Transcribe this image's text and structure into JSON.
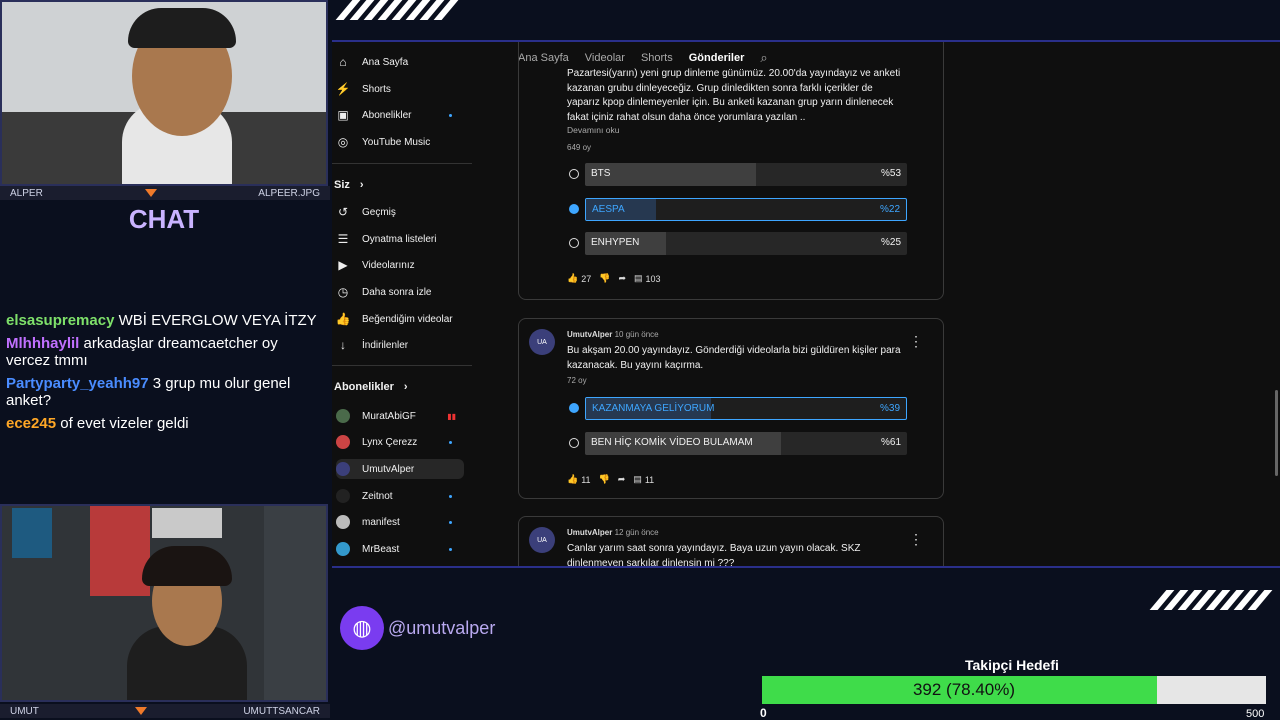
{
  "webcam_top": {
    "left_label": "ALPER",
    "right_label": "ALPEER.JPG"
  },
  "webcam_bottom": {
    "left_label": "UMUT",
    "right_label": "UMUTTSANCAR"
  },
  "chat": {
    "title": "CHAT",
    "messages": [
      {
        "user": "elsasupremacy",
        "color": "#7ee06a",
        "text": "WBİ EVERGLOW VEYA İTZY"
      },
      {
        "user": "Mlhhhaylil",
        "color": "#c070ff",
        "text": "arkadaşlar dreamcaetcher oy vercez tmmı"
      },
      {
        "user": "Partyparty_yeahh97",
        "color": "#4a8cff",
        "text": "3 grup mu olur genel anket?"
      },
      {
        "user": "ece245",
        "color": "#ffa726",
        "text": "of evet vizeler geldi"
      }
    ]
  },
  "youtube": {
    "topnav": [
      "Ana Sayfa",
      "Videolar",
      "Shorts",
      "Gönderiler"
    ],
    "active_tab": "Gönderiler",
    "sidebar": {
      "main": [
        "Ana Sayfa",
        "Shorts",
        "Abonelikler",
        "YouTube Music"
      ],
      "you_header": "Siz",
      "you": [
        "Geçmiş",
        "Oynatma listeleri",
        "Videolarınız",
        "Daha sonra izle",
        "Beğendiğim videolar",
        "İndirilenler"
      ],
      "subs_header": "Abonelikler",
      "subs": [
        "MuratAbiGF",
        "Lynx Çerezz",
        "UmutvAlper",
        "Zeitnot",
        "manifest",
        "MrBeast"
      ]
    },
    "posts": [
      {
        "text": "Pazartesi(yarın) yeni grup dinleme günümüz. 20.00'da yayındayız ve anketi kazanan grubu dinleyeceğiz. Grup dinledikten sonra farklı içerikler de yaparız kpop dinlemeyenler için. Bu anketi kazanan grup yarın dinlenecek fakat içiniz rahat olsun daha önce yorumlara yazılan ..",
        "read_more": "Devamını oku",
        "votes": "649 oy",
        "options": [
          {
            "label": "BTS",
            "pct": "%53",
            "value": 53,
            "selected": false
          },
          {
            "label": "AESPA",
            "pct": "%22",
            "value": 22,
            "selected": true
          },
          {
            "label": "ENHYPEN",
            "pct": "%25",
            "value": 25,
            "selected": false
          }
        ],
        "likes": "27",
        "comments": "103"
      },
      {
        "author": "UmutvAlper",
        "time": "10 gün önce",
        "text": "Bu akşam 20.00 yayındayız. Gönderdiği videolarla bizi güldüren kişiler para kazanacak. Bu yayını kaçırma.",
        "votes": "72 oy",
        "options": [
          {
            "label": "KAZANMAYA GELİYORUM",
            "pct": "%39",
            "value": 39,
            "selected": true
          },
          {
            "label": "BEN HİÇ KOMİK VİDEO BULAMAM",
            "pct": "%61",
            "value": 61,
            "selected": false
          }
        ],
        "likes": "11",
        "comments": "11"
      },
      {
        "author": "UmutvAlper",
        "time": "12 gün önce",
        "text": "Canlar yarım saat sonra yayındayız. Baya uzun yayın olacak. SKZ dinlenmeyen şarkılar dinlensin mi ???"
      }
    ]
  },
  "social_handle": "@umutvalper",
  "goal": {
    "title": "Takipçi Hedefi",
    "text": "392 (78.40%)",
    "fraction": 0.784,
    "min": "0",
    "max": "500"
  },
  "colors": {
    "accent": "#3ea6ff",
    "goal_fill": "#3fdc4a",
    "chat_title": "#c9b3ff"
  }
}
